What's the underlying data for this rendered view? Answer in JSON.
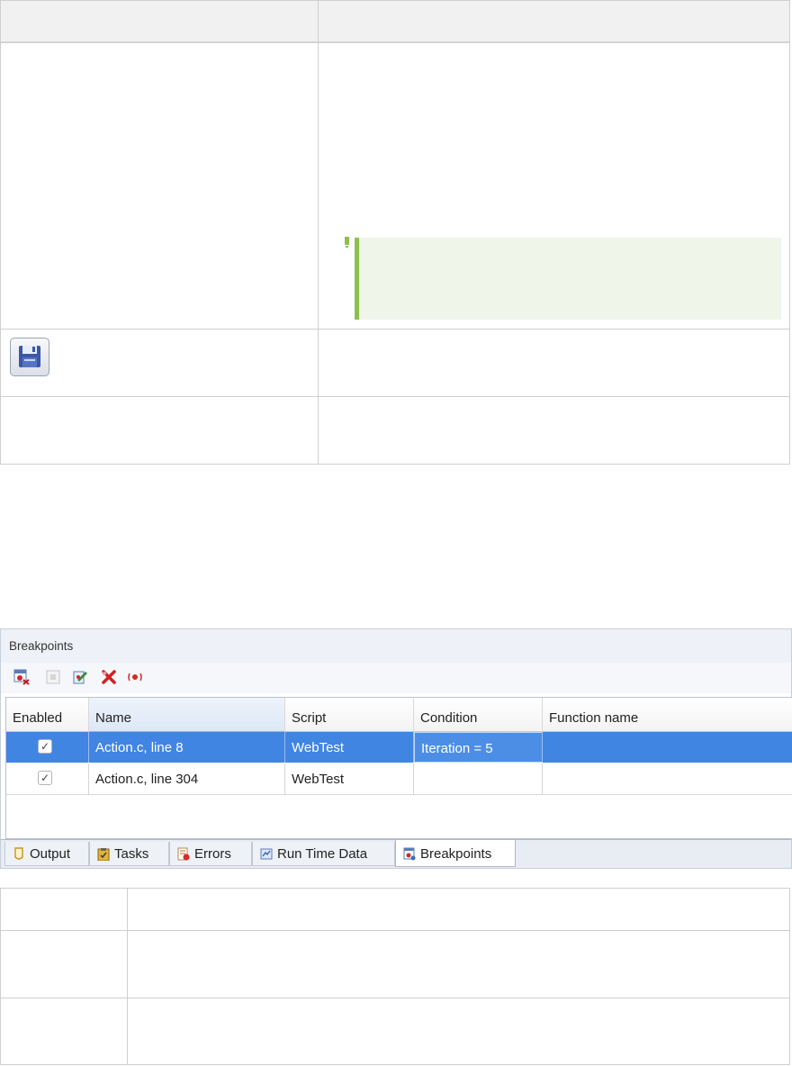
{
  "breakpoints_panel": {
    "title": "Breakpoints",
    "toolbar": [
      "breakpoint-clear-icon",
      "disabled-stop-icon",
      "edit-condition-icon",
      "delete-all-icon",
      "toggle-breakpoint-icon"
    ],
    "columns": [
      "Enabled",
      "Name",
      "Script",
      "Condition",
      "Function name"
    ],
    "rows": [
      {
        "enabled": true,
        "name": "Action.c, line 8",
        "script": "WebTest",
        "condition": "Iteration = 5",
        "function_name": "",
        "selected": true
      },
      {
        "enabled": true,
        "name": "Action.c, line 304",
        "script": "WebTest",
        "condition": "",
        "function_name": "",
        "selected": false
      }
    ],
    "tabs": [
      "Output",
      "Tasks",
      "Errors",
      "Run Time Data",
      "Breakpoints"
    ],
    "active_tab": "Breakpoints"
  },
  "icons": {
    "save": "save-disk-icon",
    "tip": "tip-marker-icon"
  },
  "colors": {
    "selection": "#4185e3",
    "tip_border": "#8cc04b",
    "tip_bg": "#eff5e9"
  }
}
